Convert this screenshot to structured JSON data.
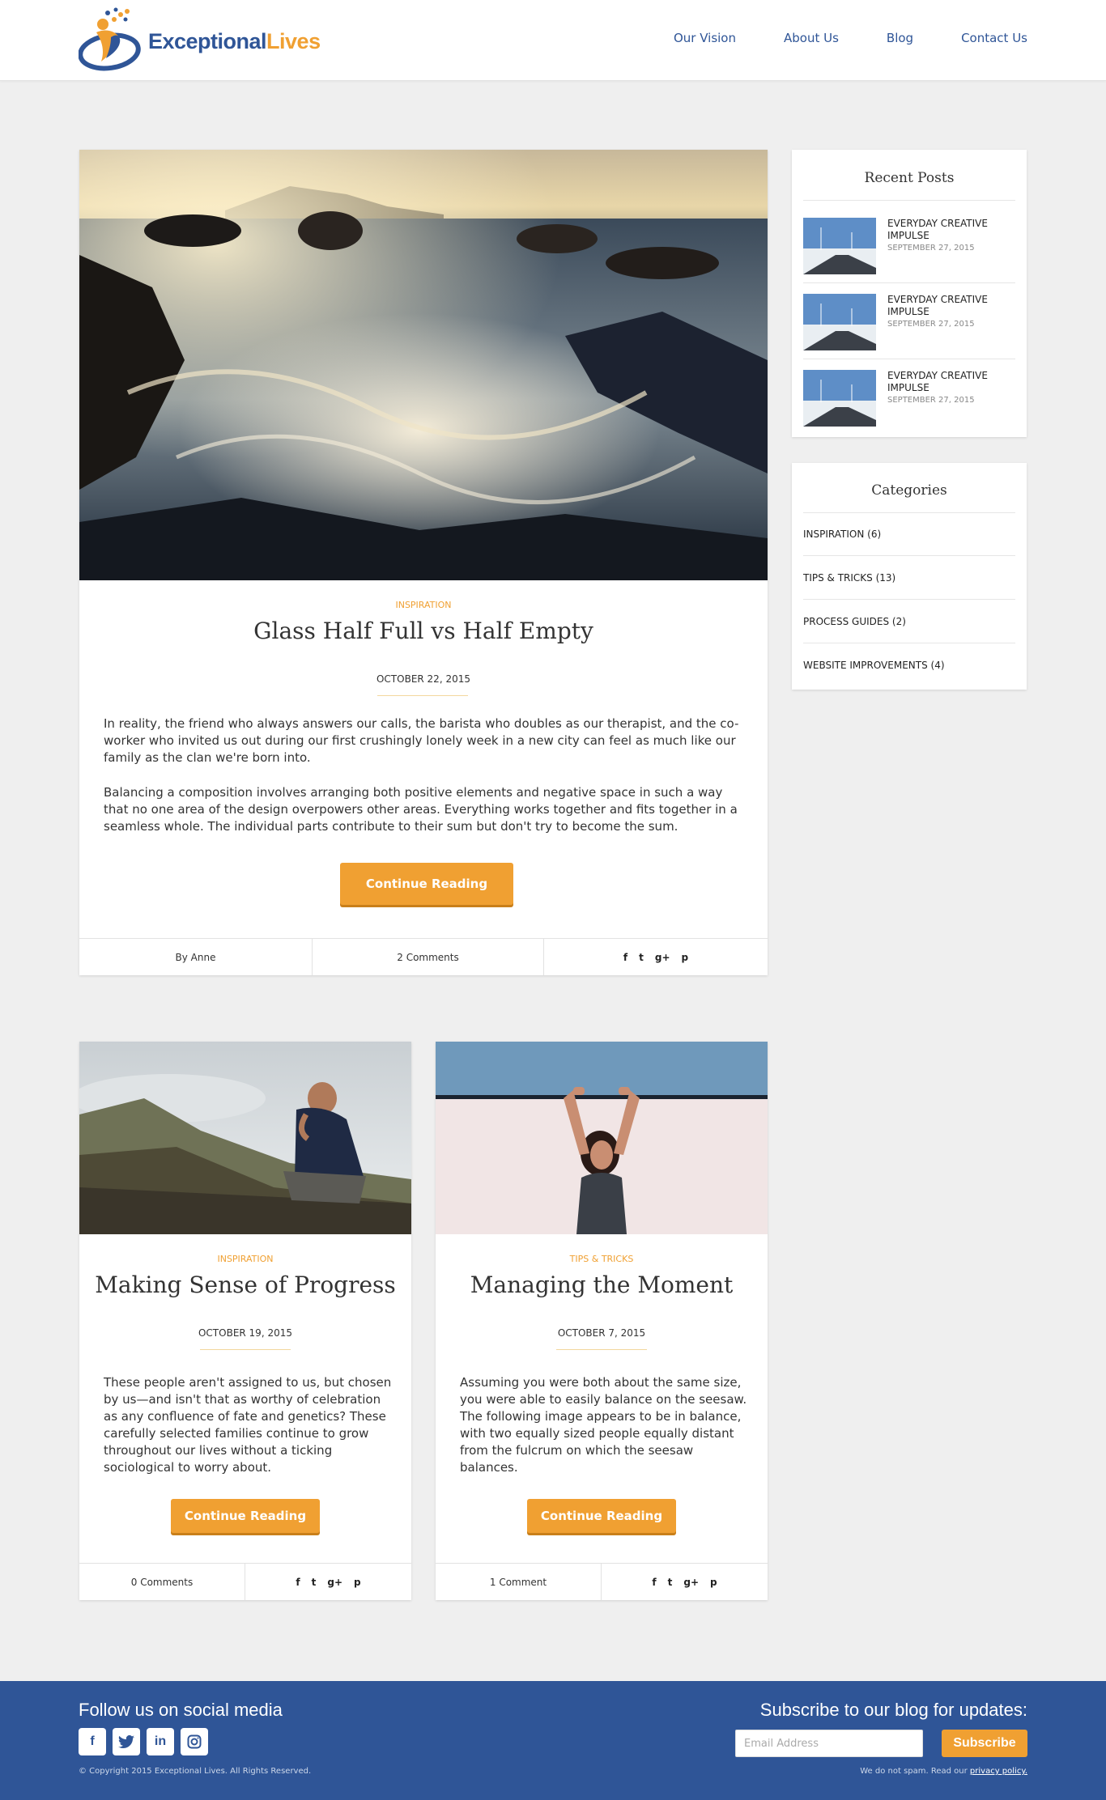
{
  "header": {
    "logo": {
      "text_main": "Exceptional",
      "text_accent": "Lives",
      "mark": "logo-mark"
    },
    "nav": [
      {
        "label": "Our Vision"
      },
      {
        "label": "About Us"
      },
      {
        "label": "Blog"
      },
      {
        "label": "Contact Us"
      }
    ]
  },
  "featured_post": {
    "category": "INSPIRATION",
    "title": "Glass Half Full vs Half Empty",
    "date": "OCTOBER 22, 2015",
    "paragraphs": [
      "In reality, the friend who always answers our calls, the barista who doubles as our therapist, and the co-worker who invited us out during our first crushingly lonely week in a new city can feel as much like our family as the clan we're born into.",
      "Balancing a composition involves arranging both positive elements and negative space in such a way that no one area of the design overpowers other areas. Everything works together and fits together in a seamless whole. The individual parts contribute to their sum but don't try to become the sum."
    ],
    "button": "Continue Reading",
    "author": "By Anne",
    "comments": "2 Comments"
  },
  "posts": [
    {
      "category": "INSPIRATION",
      "title": "Making Sense of Progress",
      "date": "OCTOBER 19, 2015",
      "excerpt": "These people aren't assigned to us, but chosen by us—and isn't that as worthy of celebration as any confluence of fate and genetics? These carefully selected families continue to grow throughout our lives without a ticking sociological to worry about.",
      "button": "Continue Reading",
      "comments": "0 Comments"
    },
    {
      "category": "TIPS & TRICKS",
      "title": "Managing the Moment",
      "date": "OCTOBER 7, 2015",
      "excerpt": "Assuming you were both about the same size, you were able to easily balance on the seesaw. The following image appears to be in balance, with two equally sized people equally distant from the fulcrum on which the seesaw balances.",
      "button": "Continue Reading",
      "comments": "1 Comment"
    }
  ],
  "share_icons": [
    "f",
    "t",
    "g+",
    "p"
  ],
  "sidebar": {
    "recent_title": "Recent Posts",
    "recent_posts": [
      {
        "title": "EVERYDAY CREATIVE IMPULSE",
        "date": "SEPTEMBER 27, 2015"
      },
      {
        "title": "EVERYDAY CREATIVE IMPULSE",
        "date": "SEPTEMBER 27, 2015"
      },
      {
        "title": "EVERYDAY CREATIVE IMPULSE",
        "date": "SEPTEMBER 27, 2015"
      }
    ],
    "categories_title": "Categories",
    "categories": [
      {
        "label": "INSPIRATION (6)"
      },
      {
        "label": "TIPS & TRICKS (13)"
      },
      {
        "label": "PROCESS GUIDES (2)"
      },
      {
        "label": "WEBSITE IMPROVEMENTS (4)"
      }
    ]
  },
  "footer": {
    "social_title": "Follow us on social media",
    "social_icons": [
      "facebook-icon",
      "twitter-icon",
      "linkedin-icon",
      "instagram-icon"
    ],
    "copyright": "© Copyright 2015 Exceptional Lives. All Rights Reserved.",
    "subscribe_title": "Subscribe to our blog for updates:",
    "email_placeholder": "Email Address",
    "subscribe_button": "Subscribe",
    "nospam_text": "We do not spam. Read our",
    "privacy_link": "privacy policy."
  },
  "colors": {
    "brand_blue": "#2f5597",
    "accent_orange": "#f0a032",
    "background": "#efefef"
  }
}
